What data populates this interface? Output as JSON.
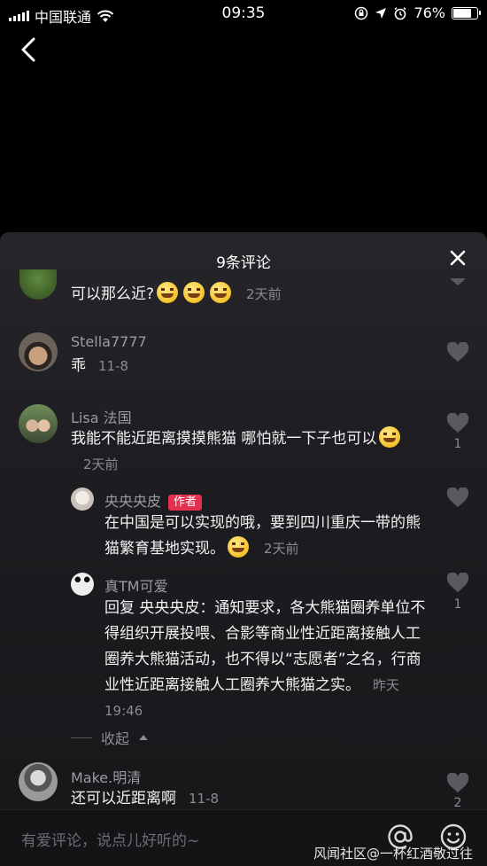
{
  "status_bar": {
    "carrier": "中国联通",
    "time": "09:35",
    "battery": "76%",
    "battery_level": 0.76
  },
  "sheet": {
    "title": "9条评论"
  },
  "comments": [
    {
      "username": "",
      "text": "可以那么近?",
      "emoji_count": 3,
      "time": "2天前"
    },
    {
      "username": "Stella7777",
      "text": "乖",
      "time": "11-8"
    },
    {
      "username": "Lisa  法国",
      "text": "我能不能近距离摸摸熊猫 哪怕就一下子也可以",
      "time": "2天前",
      "likes": "1"
    },
    {
      "username": "央央央皮",
      "tag": "作者",
      "text": "在中国是可以实现的哦，要到四川重庆一带的熊猫繁育基地实现。",
      "time": "2天前"
    },
    {
      "username": "真TM可爱",
      "text": "回复 央央央皮：通知要求，各大熊猫圈养单位不得组织开展投喂、合影等商业性近距离接触人工圈养大熊猫活动，也不得以“志愿者”之名，行商业性近距离接触人工圈养大熊猫之实。",
      "time": "昨天19:46",
      "likes": "1"
    },
    {
      "username": "Make.明清",
      "text": "还可以近距离啊",
      "time": "11-8",
      "likes": "2"
    }
  ],
  "collapse_label": "收起",
  "bottom": {
    "input_placeholder": "有爱评论，说点儿好听的~",
    "watermark": "风闻社区@一杯红酒敬过往"
  },
  "colors": {
    "author_tag": "#e3304f",
    "background": "#000000",
    "sheet": "#1f1e22"
  }
}
